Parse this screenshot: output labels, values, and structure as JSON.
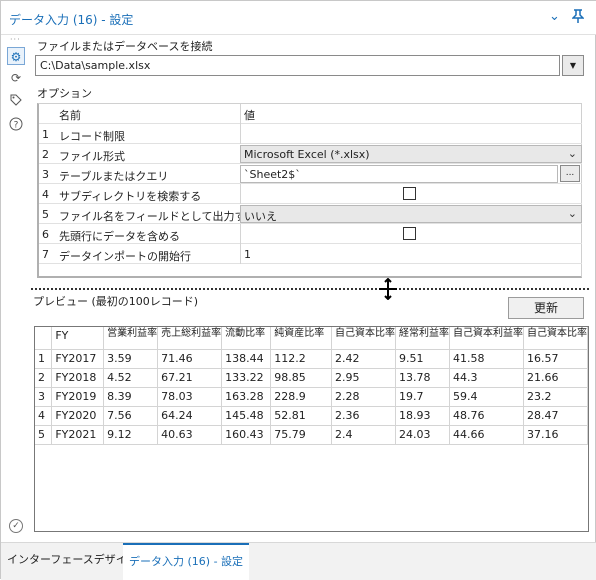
{
  "window": {
    "title": "データ入力 (16) - 設定"
  },
  "icons": {
    "collapse": "chevron-down-icon",
    "pin": "pin-icon",
    "settings": "gear-icon",
    "connect": "swirl-icon",
    "tag": "tag-icon",
    "help": "question-icon",
    "status": "check-circle-icon"
  },
  "connect_label": "ファイルまたはデータベースを接続",
  "file_path": "C:\\Data\\sample.xlsx",
  "options_label": "オプション",
  "options": {
    "header": {
      "name": "名前",
      "value": "値"
    },
    "rows": [
      {
        "num": "1",
        "name": "レコード制限",
        "value": ""
      },
      {
        "num": "2",
        "name": "ファイル形式",
        "value": "Microsoft Excel (*.xlsx)"
      },
      {
        "num": "3",
        "name": "テーブルまたはクエリ",
        "value": "`Sheet2$`",
        "button": "..."
      },
      {
        "num": "4",
        "name": "サブディレクトリを検索する",
        "checked": false
      },
      {
        "num": "5",
        "name": "ファイル名をフィールドとして出力す...",
        "value": "いいえ"
      },
      {
        "num": "6",
        "name": "先頭行にデータを含める",
        "checked": false
      },
      {
        "num": "7",
        "name": "データインポートの開始行",
        "value": "1"
      }
    ]
  },
  "preview": {
    "label": "プレビュー (最初の100レコード)",
    "refresh_label": "更新",
    "columns": [
      "FY",
      "営業利益率",
      "売上総利益率",
      "流動比率",
      "純資産比率",
      "自己資本比率",
      "経常利益率",
      "自己資本利益率",
      "自己資本比率"
    ],
    "rows": [
      [
        "1",
        "FY2017",
        "3.59",
        "71.46",
        "138.44",
        "112.2",
        "2.42",
        "9.51",
        "41.58",
        "16.57"
      ],
      [
        "2",
        "FY2018",
        "4.52",
        "67.21",
        "133.22",
        "98.85",
        "2.95",
        "13.78",
        "44.3",
        "21.66"
      ],
      [
        "3",
        "FY2019",
        "8.39",
        "78.03",
        "163.28",
        "228.9",
        "2.28",
        "19.7",
        "59.4",
        "23.2"
      ],
      [
        "4",
        "FY2020",
        "7.56",
        "64.24",
        "145.48",
        "52.81",
        "2.36",
        "18.93",
        "48.76",
        "28.47"
      ],
      [
        "5",
        "FY2021",
        "9.12",
        "40.63",
        "160.43",
        "75.79",
        "2.4",
        "24.03",
        "44.66",
        "37.16"
      ]
    ]
  },
  "tabs": [
    {
      "label": "インターフェースデザイナー",
      "active": false
    },
    {
      "label": "データ入力 (16) - 設定",
      "active": true
    }
  ]
}
